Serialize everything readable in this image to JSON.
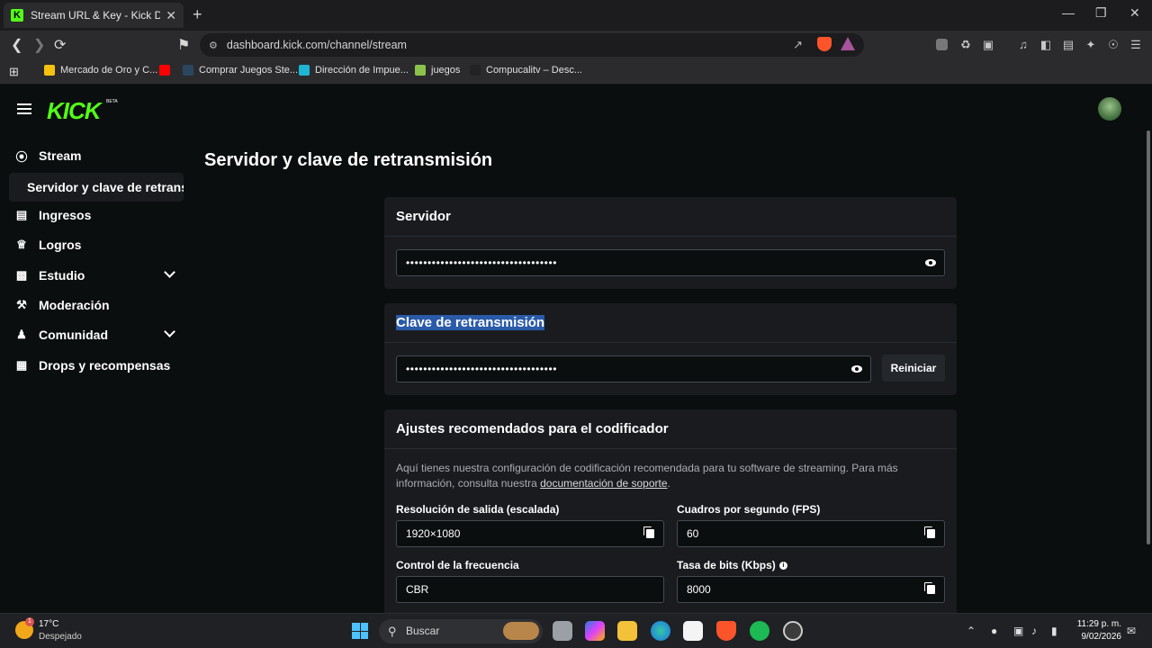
{
  "browser": {
    "tab_title": "Stream URL & Key - Kick Dashboa",
    "tab_favicon": "K",
    "url": "dashboard.kick.com/channel/stream",
    "new_tab": "+",
    "close_tab": "✕"
  },
  "bookmarks": [
    {
      "label": "Mercado de Oro y C...",
      "color": "#f4c20d"
    },
    {
      "label": "",
      "color": "#ff0000"
    },
    {
      "label": "Comprar Juegos Ste...",
      "color": "#2a475e"
    },
    {
      "label": "Dirección de Impue...",
      "color": "#1fb6d5"
    },
    {
      "label": "juegos",
      "color": "#8bc34a"
    },
    {
      "label": "Compucalitv – Desc...",
      "color": "#222222"
    }
  ],
  "kick": {
    "logo": "KICK",
    "beta": "BETA"
  },
  "sidebar": {
    "items": [
      {
        "label": "Stream",
        "icon": "broadcast-icon"
      },
      {
        "label": "Ingresos",
        "icon": "chart-icon"
      },
      {
        "label": "Logros",
        "icon": "trophy-icon"
      },
      {
        "label": "Estudio",
        "icon": "studio-icon"
      },
      {
        "label": "Moderación",
        "icon": "wrench-icon"
      },
      {
        "label": "Comunidad",
        "icon": "people-icon"
      },
      {
        "label": "Drops y recompensas",
        "icon": "gift-icon"
      }
    ],
    "sub_item": "Servidor y clave de retransmisión"
  },
  "page": {
    "title": "Servidor y clave de retransmisión",
    "server": {
      "title": "Servidor",
      "value": "•••••••••••••••••••••••••••••••••••"
    },
    "stream_key": {
      "title": "Clave de retransmisión",
      "value": "•••••••••••••••••••••••••••••••••••",
      "reset_label": "Reiniciar"
    },
    "encoder": {
      "title": "Ajustes recomendados para el codificador",
      "desc_before": "Aquí tienes nuestra configuración de codificación recomendada para tu software de streaming. Para más información, consulta nuestra ",
      "desc_link": "documentación de soporte",
      "desc_after": ".",
      "resolution_label": "Resolución de salida (escalada)",
      "resolution_value": "1920×1080",
      "fps_label": "Cuadros por segundo (FPS)",
      "fps_value": "60",
      "rate_control_label": "Control de la frecuencia",
      "rate_control_value": "CBR",
      "bitrate_label": "Tasa de bits (Kbps)",
      "bitrate_value": "8000"
    }
  },
  "taskbar": {
    "temp": "17°C",
    "weather": "Despejado",
    "weather_badge": "1",
    "search_placeholder": "Buscar",
    "time": "11:29 p. m.",
    "date": "9/02/2026"
  }
}
